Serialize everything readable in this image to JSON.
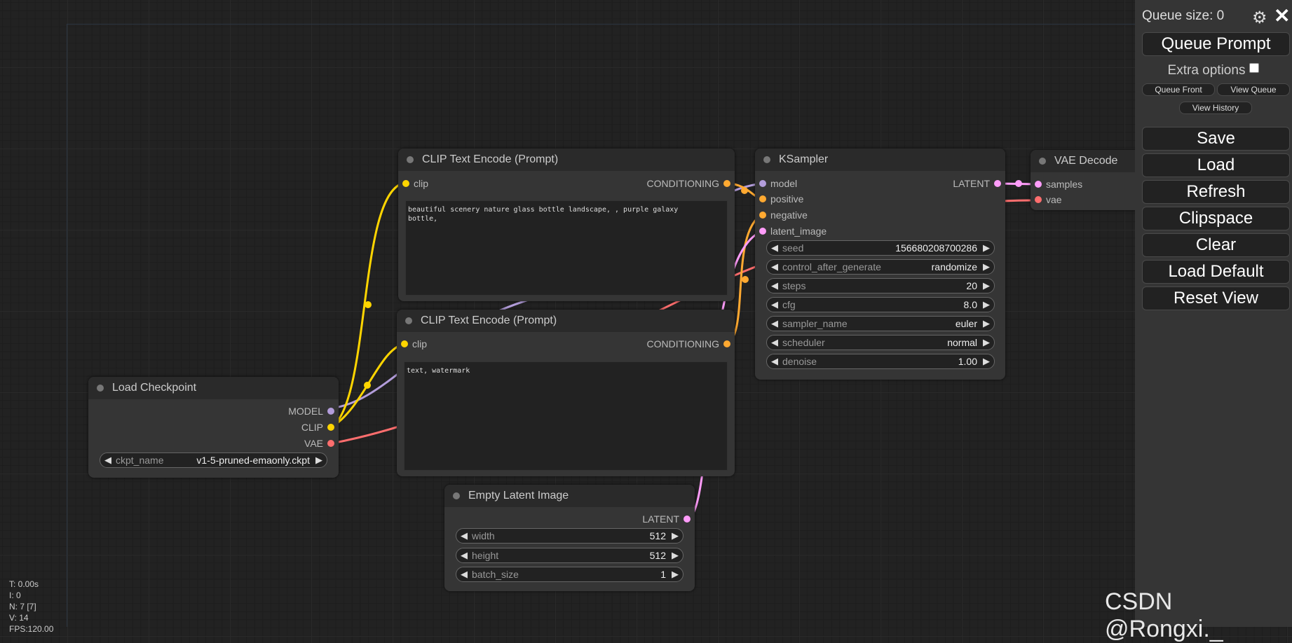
{
  "colors": {
    "clip": "#ffd500",
    "conditioning": "#ffa931",
    "model": "#b39ddb",
    "vae": "#ff6e6e",
    "latent": "#ff9cf9"
  },
  "nodes": {
    "clip_pos": {
      "title": "CLIP Text Encode (Prompt)",
      "input": "clip",
      "output": "CONDITIONING",
      "text": "beautiful scenery nature glass bottle landscape, , purple galaxy\nbottle,"
    },
    "clip_neg": {
      "title": "CLIP Text Encode (Prompt)",
      "input": "clip",
      "output": "CONDITIONING",
      "text": "text, watermark"
    },
    "ksampler": {
      "title": "KSampler",
      "inputs": [
        "model",
        "positive",
        "negative",
        "latent_image"
      ],
      "output": "LATENT",
      "widgets": [
        {
          "label": "seed",
          "value": "156680208700286"
        },
        {
          "label": "control_after_generate",
          "value": "randomize"
        },
        {
          "label": "steps",
          "value": "20"
        },
        {
          "label": "cfg",
          "value": "8.0"
        },
        {
          "label": "sampler_name",
          "value": "euler"
        },
        {
          "label": "scheduler",
          "value": "normal"
        },
        {
          "label": "denoise",
          "value": "1.00"
        }
      ]
    },
    "vae_decode": {
      "title": "VAE Decode",
      "inputs": [
        "samples",
        "vae"
      ]
    },
    "load_checkpoint": {
      "title": "Load Checkpoint",
      "outputs": [
        "MODEL",
        "CLIP",
        "VAE"
      ],
      "widget": {
        "label": "ckpt_name",
        "value": "v1-5-pruned-emaonly.ckpt"
      }
    },
    "empty_latent": {
      "title": "Empty Latent Image",
      "output": "LATENT",
      "widgets": [
        {
          "label": "width",
          "value": "512"
        },
        {
          "label": "height",
          "value": "512"
        },
        {
          "label": "batch_size",
          "value": "1"
        }
      ]
    }
  },
  "menu": {
    "queue_size": "Queue size: 0",
    "queue_prompt": "Queue Prompt",
    "extra_options": "Extra options",
    "queue_front": "Queue Front",
    "view_queue": "View Queue",
    "view_history": "View History",
    "save": "Save",
    "load": "Load",
    "refresh": "Refresh",
    "clipspace": "Clipspace",
    "clear": "Clear",
    "load_default": "Load Default",
    "reset_view": "Reset View"
  },
  "stats": [
    "T: 0.00s",
    "I: 0",
    "N: 7 [7]",
    "V: 14",
    "FPS:120.00"
  ],
  "watermark": "CSDN @Rongxi._"
}
